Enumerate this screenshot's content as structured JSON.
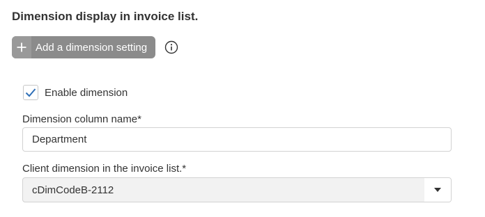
{
  "section": {
    "title": "Dimension display in invoice list."
  },
  "add_button": {
    "label": "Add a dimension setting",
    "icon": "plus-icon"
  },
  "info": {
    "icon": "info-icon"
  },
  "enable_dimension": {
    "label": "Enable dimension",
    "checked": true
  },
  "dimension_column": {
    "label": "Dimension column name*",
    "value": "Department"
  },
  "client_dimension": {
    "label": "Client dimension in the invoice list.*",
    "selected": "cDimCodeB-2112"
  },
  "colors": {
    "button_bg": "#8b8b8b",
    "checkmark": "#2f6fb7",
    "select_bg": "#f2f2f2",
    "border": "#d2d2d2"
  }
}
